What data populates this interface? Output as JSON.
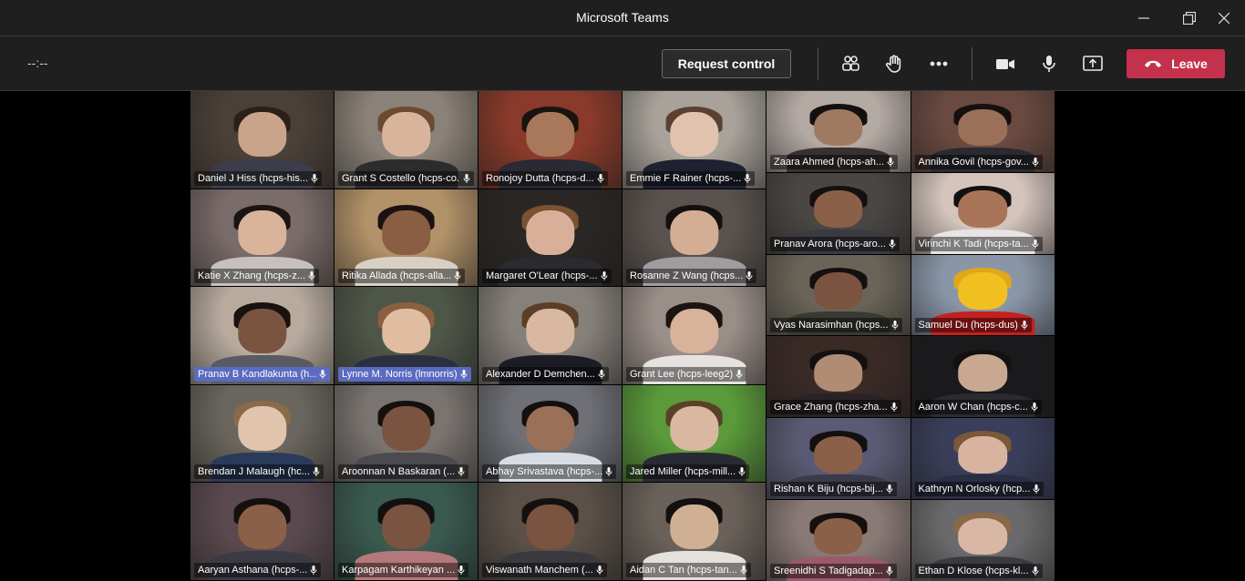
{
  "window": {
    "title": "Microsoft Teams"
  },
  "toolbar": {
    "timer": "--:--",
    "request_control_label": "Request control",
    "leave_label": "Leave"
  },
  "colors": {
    "leave": "#c4314b",
    "highlight_name": "#5b6bbf",
    "chrome": "#1f1f1f"
  },
  "icons": [
    "participants-icon",
    "raise-hand-icon",
    "more-options-icon",
    "camera-icon",
    "microphone-icon",
    "share-screen-icon",
    "phone-hangup-icon",
    "minimize-icon",
    "restore-icon",
    "close-icon"
  ],
  "tiles_left": [
    {
      "name": "Daniel J Hiss (hcps-his...",
      "bg": "#4a4038",
      "skin": "#c9a48a",
      "hair": "#2a2018",
      "shirt": "#3c3c4a"
    },
    {
      "name": "Grant S Costello (hcps-co...",
      "bg": "#8a8178",
      "skin": "#d8b49c",
      "hair": "#6b4a32",
      "shirt": "#2c2c2c"
    },
    {
      "name": "Ronojoy Dutta (hcps-d...",
      "bg": "#8a3a2a",
      "skin": "#a9785a",
      "hair": "#1a1410",
      "shirt": "#2a2a34"
    },
    {
      "name": "Emmie F Rainer (hcps-...",
      "bg": "#a8a29a",
      "skin": "#e0c2ae",
      "hair": "#5a4030",
      "shirt": "#1e2230"
    },
    {
      "name": "Katie X Zhang (hcps-z...",
      "bg": "#7a6c6a",
      "skin": "#d9b49a",
      "hair": "#1a1412",
      "shirt": "#c8bfc0"
    },
    {
      "name": "Ritika Allada (hcps-alla...",
      "bg": "#b29268",
      "skin": "#8a5e42",
      "hair": "#1a1210",
      "shirt": "#d8d0c4"
    },
    {
      "name": "Margaret O'Lear (hcps-...",
      "bg": "#2a2624",
      "skin": "#d8b09a",
      "hair": "#7a5232",
      "shirt": "#2a2a30"
    },
    {
      "name": "Rosanne Z Wang (hcps...",
      "bg": "#5a524e",
      "skin": "#d4ae94",
      "hair": "#141010",
      "shirt": "#a09ca0"
    },
    {
      "name": "Pranav B Kandlakunta (h...",
      "bg": "#b8ab9e",
      "skin": "#7a5440",
      "hair": "#1a1210",
      "shirt": "#5a5a62",
      "hl": true
    },
    {
      "name": "Lynne M. Norris (lmnorris)",
      "bg": "#4e5648",
      "skin": "#e0bca0",
      "hair": "#8a6040",
      "shirt": "#2a3040",
      "hl": true
    },
    {
      "name": "Alexander D Demchen...",
      "bg": "#86807a",
      "skin": "#d8b8a0",
      "hair": "#5a3e28",
      "shirt": "#1c1c24"
    },
    {
      "name": "Grant Lee (hcps-leeg2)",
      "bg": "#9a8e88",
      "skin": "#d8b29a",
      "hair": "#1a1412",
      "shirt": "#e6e2e0"
    },
    {
      "name": "Brendan J Malaugh (hc...",
      "bg": "#6a665e",
      "skin": "#e0c4ae",
      "hair": "#8a6a48",
      "shirt": "#2a3a5a"
    },
    {
      "name": "Aroonnan N Baskaran (...",
      "bg": "#7a7470",
      "skin": "#7a5440",
      "hair": "#141010",
      "shirt": "#4a4a50"
    },
    {
      "name": "Abhay Srivastava (hcps-...",
      "bg": "#6e7076",
      "skin": "#9a7058",
      "hair": "#141010",
      "shirt": "#d8dce4"
    },
    {
      "name": "Jared Miller (hcps-mill...",
      "bg": "#5a9a3a",
      "skin": "#d8b8a0",
      "hair": "#5a4028",
      "shirt": "#2a2a34"
    },
    {
      "name": "Aaryan Asthana (hcps-...",
      "bg": "#5a4a50",
      "skin": "#8a6048",
      "hair": "#141010",
      "shirt": "#3a3a44"
    },
    {
      "name": "Karpagam Karthikeyan ...",
      "bg": "#3a5a50",
      "skin": "#7a5440",
      "hair": "#141010",
      "shirt": "#b4787a"
    },
    {
      "name": "Viswanath Manchem (...",
      "bg": "#5a5048",
      "skin": "#7a5440",
      "hair": "#141010",
      "shirt": "#3a3a3e"
    },
    {
      "name": "Aidan C Tan (hcps-tan...",
      "bg": "#6a625a",
      "skin": "#d0b094",
      "hair": "#141010",
      "shirt": "#e4e0dc"
    }
  ],
  "tiles_right": [
    {
      "name": "Zaara Ahmed (hcps-ah...",
      "bg": "#b4aaa4",
      "skin": "#a07a60",
      "hair": "#141010",
      "shirt": "#3a3030"
    },
    {
      "name": "Annika Govil (hcps-gov...",
      "bg": "#6a4a40",
      "skin": "#9a7058",
      "hair": "#141010",
      "shirt": "#2a2a30"
    },
    {
      "name": "Pranav Arora (hcps-aro...",
      "bg": "#4a4644",
      "skin": "#8a6048",
      "hair": "#141010",
      "shirt": "#3a3a40"
    },
    {
      "name": "Virinchi K Tadi (hcps-ta...",
      "bg": "#d4c4bc",
      "skin": "#a87458",
      "hair": "#141010",
      "shirt": "#e8e4e4"
    },
    {
      "name": "Vyas Narasimhan (hcps...",
      "bg": "#6a6458",
      "skin": "#7a5440",
      "hair": "#141010",
      "shirt": "#3a3a34"
    },
    {
      "name": "Samuel Du (hcps-dus)",
      "bg": "#8a96a8",
      "skin": "#f0c020",
      "hair": "#e0a818",
      "shirt": "#c42020"
    },
    {
      "name": "Grace Zhang (hcps-zha...",
      "bg": "#3a2a26",
      "skin": "#b08c74",
      "hair": "#141010",
      "shirt": "#2a2226"
    },
    {
      "name": "Aaron W Chan (hcps-c...",
      "bg": "#1a1a1c",
      "skin": "#c8a890",
      "hair": "#141010",
      "shirt": "#2a2a30"
    },
    {
      "name": "Rishan K Biju (hcps-bij...",
      "bg": "#5a5a74",
      "skin": "#8a6048",
      "hair": "#141010",
      "shirt": "#3a3a4a"
    },
    {
      "name": "Kathryn N Orlosky (hcp...",
      "bg": "#3a3e5a",
      "skin": "#d8b4a0",
      "hair": "#7a5838",
      "shirt": "#2a2e44"
    },
    {
      "name": "Sreenidhi S Tadigadap...",
      "bg": "#8a7a76",
      "skin": "#8a6048",
      "hair": "#141010",
      "shirt": "#9a5a6a"
    },
    {
      "name": "Ethan D Klose (hcps-kl...",
      "bg": "#6a6a6c",
      "skin": "#d8b8a4",
      "hair": "#8a6848",
      "shirt": "#3a3a40"
    }
  ]
}
